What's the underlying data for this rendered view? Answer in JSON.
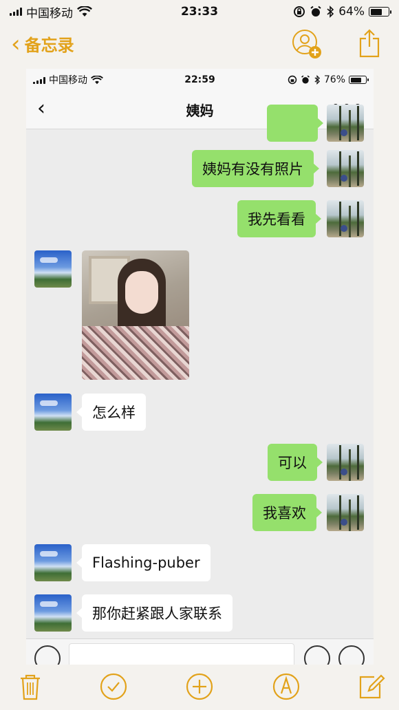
{
  "outer_status": {
    "carrier": "中国移动",
    "time": "23:33",
    "battery": "64%",
    "battery_level": 0.64
  },
  "notes_header": {
    "back_label": "备忘录",
    "accent_color": "#e2a21a"
  },
  "inner_status": {
    "carrier": "中国移动",
    "time": "22:59",
    "battery": "76%",
    "battery_level": 0.76
  },
  "chat": {
    "title": "姨妈",
    "more": "•••",
    "messages": [
      {
        "side": "me",
        "text": ""
      },
      {
        "side": "me",
        "text": "姨妈有没有照片"
      },
      {
        "side": "me",
        "text": "我先看看"
      },
      {
        "side": "them",
        "type": "image",
        "text": ""
      },
      {
        "side": "them",
        "text": "怎么样"
      },
      {
        "side": "me",
        "text": "可以"
      },
      {
        "side": "me",
        "text": "我喜欢"
      },
      {
        "side": "them",
        "text": "Flashing-puber"
      },
      {
        "side": "them",
        "text": "那你赶紧跟人家联系"
      }
    ]
  },
  "colors": {
    "my_bubble": "#95e06c",
    "their_bubble": "#ffffff",
    "chat_bg": "#ececec"
  },
  "toolbar": {
    "icons": [
      "trash-icon",
      "checklist-icon",
      "add-icon",
      "markup-icon",
      "compose-icon"
    ]
  }
}
